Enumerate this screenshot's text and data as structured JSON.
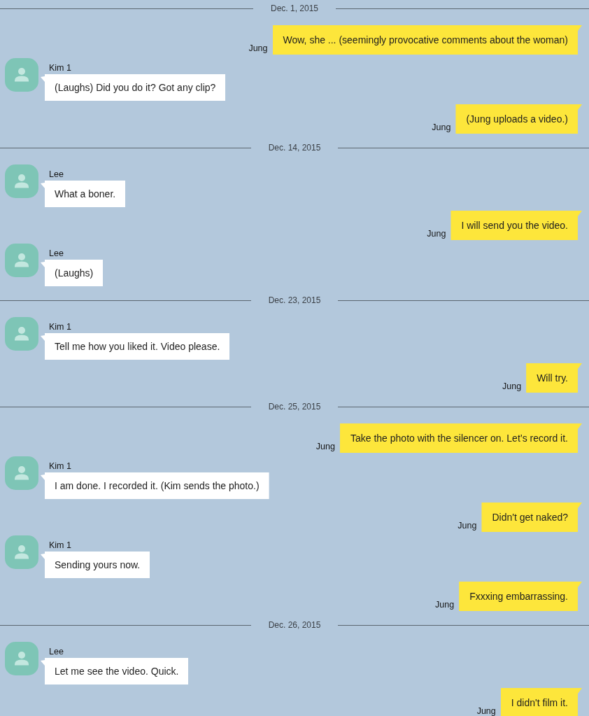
{
  "sections": [
    {
      "date": "Dec. 1, 2015",
      "messages": [
        {
          "kind": "outgoing",
          "sender": "Jung",
          "text": "Wow, she ... (seemingly provocative comments about the woman)"
        },
        {
          "kind": "incoming",
          "sender": "Kim 1",
          "text": "(Laughs) Did you do it? Got any clip?"
        },
        {
          "kind": "outgoing",
          "sender": "Jung",
          "text": "(Jung uploads a video.)"
        }
      ]
    },
    {
      "date": "Dec. 14, 2015",
      "messages": [
        {
          "kind": "incoming",
          "sender": "Lee",
          "text": "What a boner."
        },
        {
          "kind": "outgoing",
          "sender": "Jung",
          "text": "I will send you the video."
        },
        {
          "kind": "incoming",
          "sender": "Lee",
          "text": "(Laughs)"
        }
      ]
    },
    {
      "date": "Dec. 23, 2015",
      "messages": [
        {
          "kind": "incoming",
          "sender": "Kim 1",
          "text": "Tell me how you liked it. Video please."
        },
        {
          "kind": "outgoing",
          "sender": "Jung",
          "text": "Will try."
        }
      ]
    },
    {
      "date": "Dec. 25, 2015",
      "messages": [
        {
          "kind": "outgoing",
          "sender": "Jung",
          "text": "Take the photo with the silencer on. Let’s record it."
        },
        {
          "kind": "incoming",
          "sender": "Kim 1",
          "text": "I am done. I recorded it. (Kim sends the photo.)"
        },
        {
          "kind": "outgoing",
          "sender": "Jung",
          "text": "Didn't get naked?"
        },
        {
          "kind": "incoming",
          "sender": "Kim 1",
          "text": "Sending yours now."
        },
        {
          "kind": "outgoing",
          "sender": "Jung",
          "text": "Fxxxing embarrassing."
        }
      ]
    },
    {
      "date": "Dec. 26, 2015",
      "messages": [
        {
          "kind": "incoming",
          "sender": "Lee",
          "text": "Let me see the video. Quick."
        },
        {
          "kind": "outgoing",
          "sender": "Jung",
          "text": "I didn't film it."
        }
      ]
    }
  ]
}
